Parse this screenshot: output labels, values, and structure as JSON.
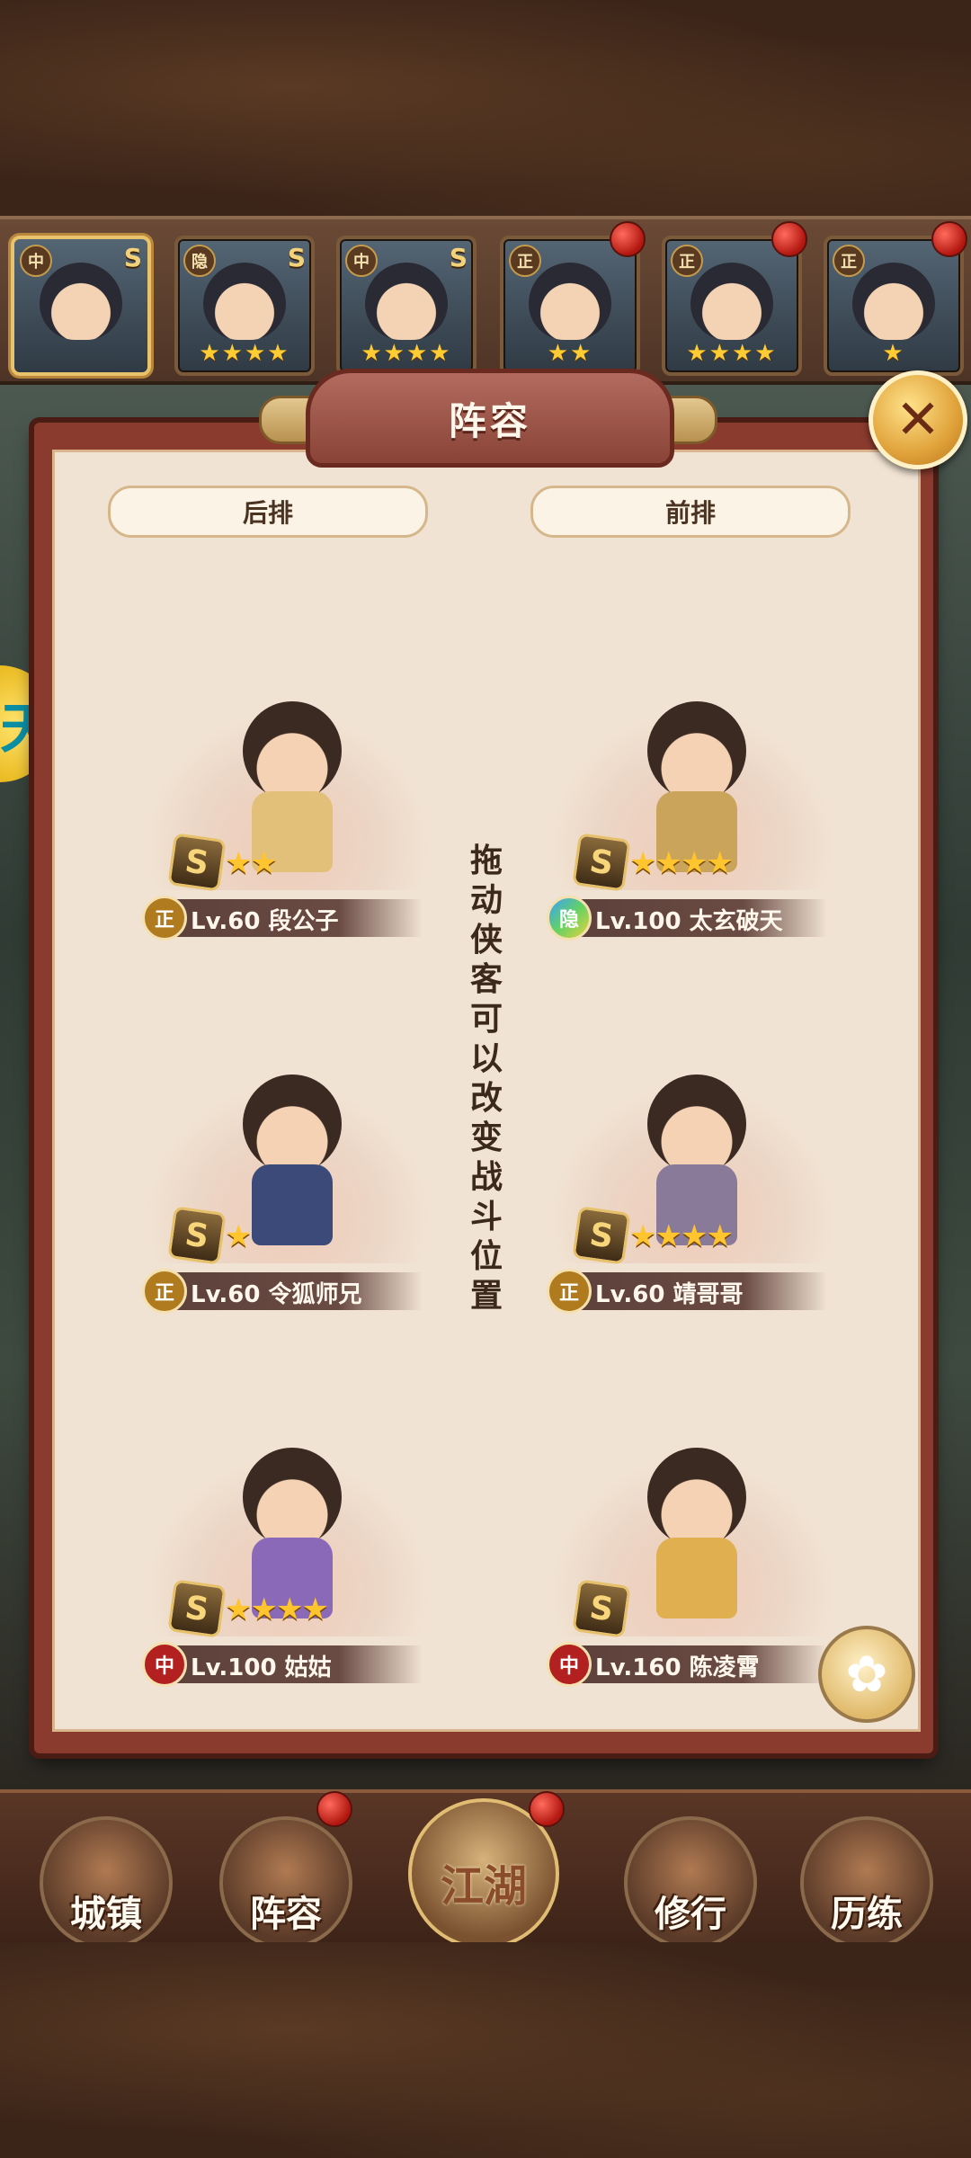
{
  "panel": {
    "title": "阵容",
    "close_icon": "close-x-icon",
    "back_row_label": "后排",
    "front_row_label": "前排",
    "hint": "拖动侠客可以改变战斗位置"
  },
  "hero_strip": [
    {
      "faction": "中",
      "rank": "S",
      "stars": "",
      "selected": true
    },
    {
      "faction": "隐",
      "rank": "S",
      "stars": "★★★★",
      "selected": false
    },
    {
      "faction": "中",
      "rank": "S",
      "stars": "★★★★",
      "selected": false
    },
    {
      "faction": "正",
      "rank": "",
      "stars": "★★",
      "selected": false
    },
    {
      "faction": "正",
      "rank": "",
      "stars": "★★★★",
      "selected": false
    },
    {
      "faction": "正",
      "rank": "",
      "stars": "★",
      "selected": false
    }
  ],
  "slots": [
    {
      "faction": "正",
      "level_name": "Lv.60 段公子",
      "rank": "S",
      "stars": "★★",
      "row": "后排"
    },
    {
      "faction": "隐",
      "level_name": "Lv.100 太玄破天",
      "rank": "S",
      "stars": "★★★★",
      "row": "前排"
    },
    {
      "faction": "正",
      "level_name": "Lv.60 令狐师兄",
      "rank": "S",
      "stars": "★",
      "row": "后排"
    },
    {
      "faction": "正",
      "level_name": "Lv.60 靖哥哥",
      "rank": "S",
      "stars": "★★★★",
      "row": "前排"
    },
    {
      "faction": "中",
      "level_name": "Lv.100 姑姑",
      "rank": "S",
      "stars": "★★★★",
      "row": "后排"
    },
    {
      "faction": "中",
      "level_name": "Lv.160 陈凌霄",
      "rank": "S",
      "stars": "",
      "row": "前排"
    }
  ],
  "bottom_nav": [
    {
      "label": "城镇"
    },
    {
      "label": "阵容"
    },
    {
      "label": "江湖"
    },
    {
      "label": "修行"
    },
    {
      "label": "历练"
    }
  ],
  "colors": {
    "panel_bg": "#f1e3d3",
    "frame": "#8a3b2e",
    "star": "#ffc52e",
    "notification": "#c21a12"
  }
}
